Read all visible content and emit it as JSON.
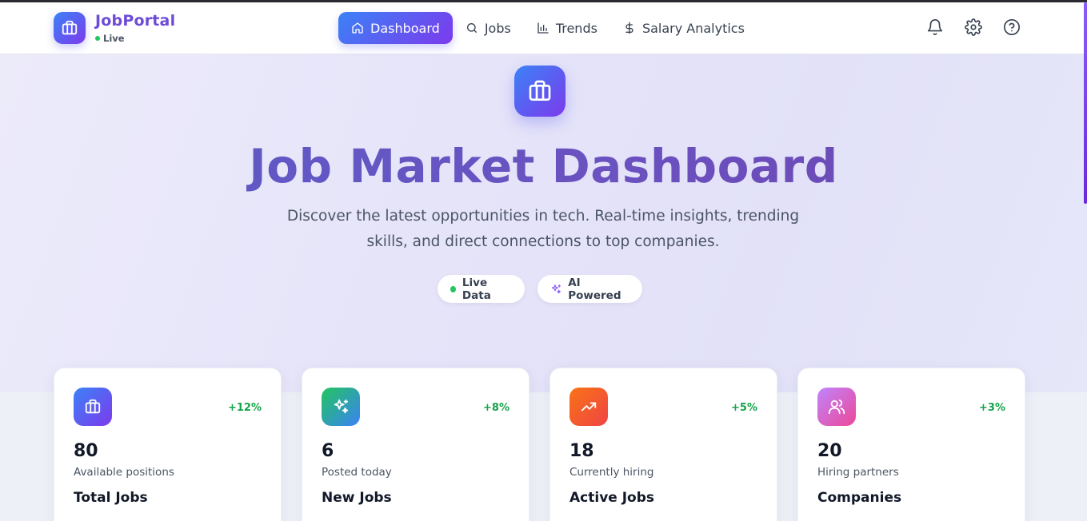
{
  "brand": {
    "name": "JobPortal",
    "status": "Live",
    "logo_icon": "briefcase-icon"
  },
  "nav": {
    "items": [
      {
        "label": "Dashboard",
        "icon": "home-icon",
        "active": true
      },
      {
        "label": "Jobs",
        "icon": "search-icon",
        "active": false
      },
      {
        "label": "Trends",
        "icon": "bar-chart-icon",
        "active": false
      },
      {
        "label": "Salary Analytics",
        "icon": "dollar-icon",
        "active": false
      }
    ],
    "actions": [
      "bell-icon",
      "gear-icon",
      "help-icon"
    ]
  },
  "hero": {
    "icon": "briefcase-icon",
    "title": "Job Market Dashboard",
    "subtitle": "Discover the latest opportunities in tech. Real-time insights, trending skills, and direct connections to top companies.",
    "badges": [
      {
        "label": "Live Data",
        "icon": "green-dot"
      },
      {
        "label": "AI Powered",
        "icon": "sparkles-icon"
      }
    ]
  },
  "stats": [
    {
      "value": "80",
      "label": "Available positions",
      "title": "Total Jobs",
      "delta": "+12%",
      "icon": "briefcase-icon",
      "color_from": "#3b82f6",
      "color_to": "#7c3aed"
    },
    {
      "value": "6",
      "label": "Posted today",
      "title": "New Jobs",
      "delta": "+8%",
      "icon": "sparkles-icon",
      "color_from": "#22c55e",
      "color_to": "#3b82f6"
    },
    {
      "value": "18",
      "label": "Currently hiring",
      "title": "Active Jobs",
      "delta": "+5%",
      "icon": "trending-up-icon",
      "color_from": "#f97316",
      "color_to": "#ef4444"
    },
    {
      "value": "20",
      "label": "Hiring partners",
      "title": "Companies",
      "delta": "+3%",
      "icon": "users-icon",
      "color_from": "#c084fc",
      "color_to": "#ec4899"
    }
  ]
}
